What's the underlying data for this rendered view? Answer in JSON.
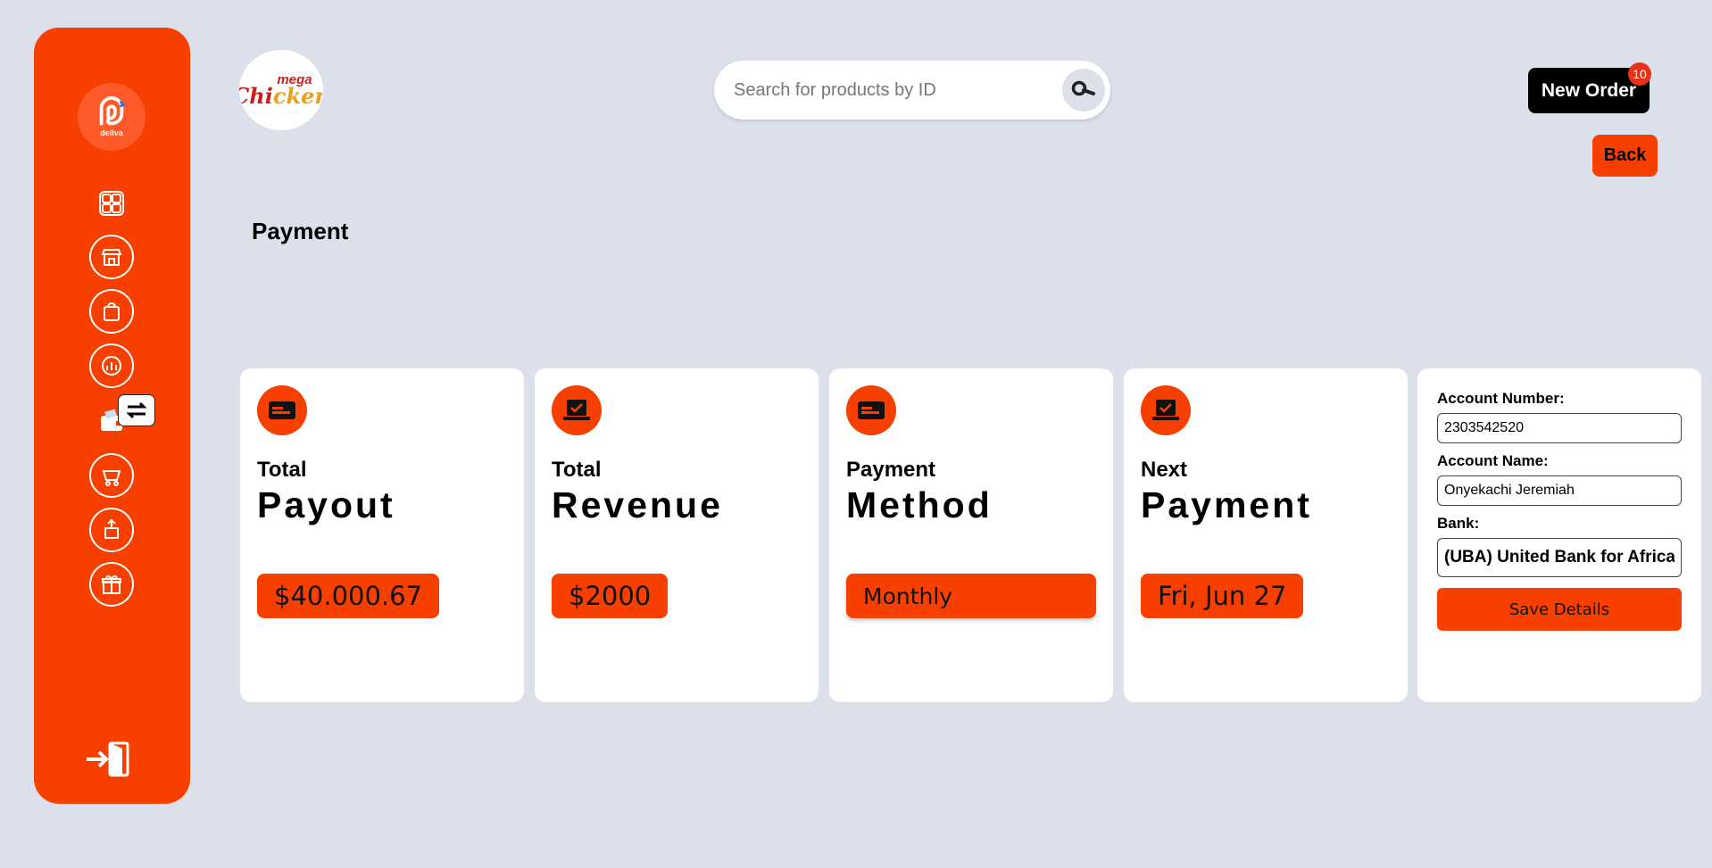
{
  "sidebar": {
    "brand_word": "deliva",
    "items": [
      "dashboard-icon",
      "restaurant-icon",
      "bag-icon",
      "analytics-icon",
      "wallet-icon",
      "basket-icon",
      "delivery-box-icon",
      "gift-icon"
    ],
    "logout": "logout-icon"
  },
  "header": {
    "brand": {
      "line1": "mega",
      "line2_a": "Chi",
      "line2_b": "cken"
    },
    "search": {
      "placeholder": "Search for products by ID"
    },
    "new_order": {
      "label": "New Order",
      "badge": "10"
    },
    "back_label": "Back"
  },
  "page": {
    "title": "Payment"
  },
  "cards": [
    {
      "line1": "Total",
      "line2": "Payout",
      "value": "$40.000.67"
    },
    {
      "line1": "Total",
      "line2": "Revenue",
      "value": "$2000"
    },
    {
      "line1": "Payment",
      "line2": "Method",
      "value": "Monthly"
    },
    {
      "line1": "Next",
      "line2": "Payment",
      "value": "Fri, Jun 27"
    }
  ],
  "account_form": {
    "account_number_label": "Account Number:",
    "account_number": "2303542520",
    "account_name_label": "Account Name:",
    "account_name": "Onyekachi Jeremiah",
    "bank_label": "Bank:",
    "bank": "(UBA) United Bank for Africa",
    "save_label": "Save Details"
  },
  "colors": {
    "accent": "#f74000",
    "background": "#dce0eb",
    "card": "#ffffff"
  }
}
